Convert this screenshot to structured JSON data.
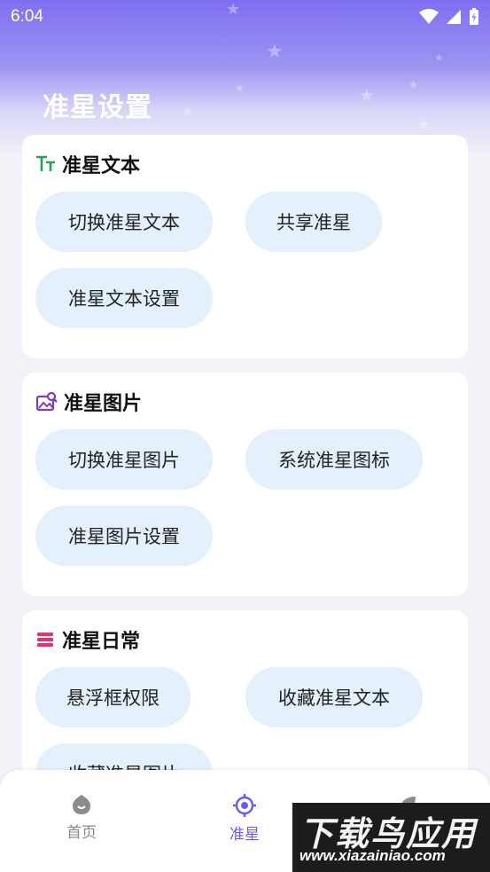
{
  "status_bar": {
    "time": "6:04"
  },
  "header": {
    "title": "准星设置"
  },
  "sections": [
    {
      "title": "准星文本",
      "icon": "text-size-icon",
      "icon_color": "#2e9e5b",
      "buttons": [
        "切换准星文本",
        "共享准星",
        "准星文本设置"
      ]
    },
    {
      "title": "准星图片",
      "icon": "image-search-icon",
      "icon_color": "#7b3fb3",
      "buttons": [
        "切换准星图片",
        "系统准星图标",
        "准星图片设置"
      ]
    },
    {
      "title": "准星日常",
      "icon": "menu-lines-icon",
      "icon_color": "#e8306b",
      "buttons": [
        "悬浮框权限",
        "收藏准星文本",
        "收藏准星图片"
      ]
    }
  ],
  "bottom_nav": {
    "items": [
      {
        "label": "首页",
        "icon": "home-icon",
        "active": false
      },
      {
        "label": "准星",
        "icon": "crosshair-icon",
        "active": true
      },
      {
        "label": "",
        "icon": "leaf-icon",
        "active": false
      }
    ]
  },
  "watermark": {
    "brand": "下载鸟应用",
    "url": "www.xiazainiao.com"
  },
  "colors": {
    "accent": "#6d5ce8",
    "pill_bg": "#e4f0fb",
    "header_gradient_top": "#7d6ff0"
  }
}
